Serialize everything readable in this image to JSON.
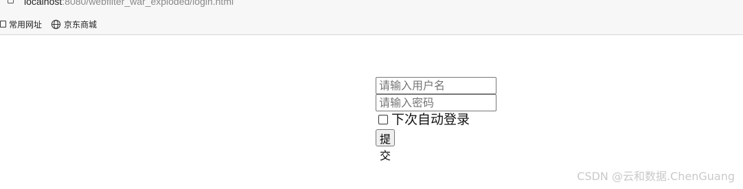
{
  "address_bar": {
    "url_host": "localhost",
    "url_rest": ":8080/webfilter_war_exploded/login.html"
  },
  "bookmarks": [
    {
      "label": "常用网址",
      "icon": "folder-icon"
    },
    {
      "label": "京东商城",
      "icon": "globe-icon"
    }
  ],
  "form": {
    "username_placeholder": "请输入用户名",
    "password_placeholder": "请输入密码",
    "remember_label": "下次自动登录",
    "remember_checked": false,
    "submit_label": "提交"
  },
  "watermark": "CSDN @云和数据.ChenGuang"
}
